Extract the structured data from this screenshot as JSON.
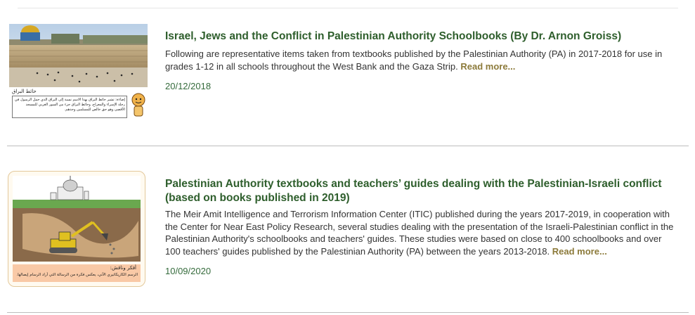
{
  "articles": [
    {
      "title": "Israel, Jews and the Conflict in Palestinian Authority Schoolbooks (By Dr. Arnon Groiss)",
      "excerpt": "Following are representative items taken from textbooks published by the Palestinian Authority (PA) in 2017-2018 for use in grades 1-12 in all schools throughout the West Bank and the Gaza Strip.",
      "read_more": "Read more...",
      "date": "20/12/2018",
      "thumbnail": {
        "caption_label": "حائط البراق",
        "caption_text": "إضاءة: تشير حائط البراق بهذا الاسم نسبة إلى البراق الذي حمل الرسول في رحلة الإسراء والمعراج، وحائط البراق جزء من السور الغربي للمسجد الأقصى وهو حق خالص للمسلمين وحدهم."
      }
    },
    {
      "title": "Palestinian Authority textbooks and teachers’ guides dealing with the Palestinian-Israeli conflict (based on books published in 2019)",
      "excerpt": "The Meir Amit Intelligence and Terrorism Information Center (ITIC) published during the years 2017-2019, in cooperation with the Center for Near East Policy Research, several studies dealing with the presentation of the Israeli-Palestinian conflict in the Palestinian Authority's schoolbooks and teachers' guides. These studies were based on close to 400 schoolbooks and over 100 teachers' guides published by the Palestinian Authority (PA) between the years 2013-2018.",
      "read_more": "Read more...",
      "date": "10/09/2020",
      "thumbnail": {
        "caption_label": "أفكر وناقش:",
        "caption_text": "الرسم الكاريكاتيري الآتي، يعكس فكرة من الرسالة التي أراد الرسام إيصالها."
      }
    }
  ]
}
